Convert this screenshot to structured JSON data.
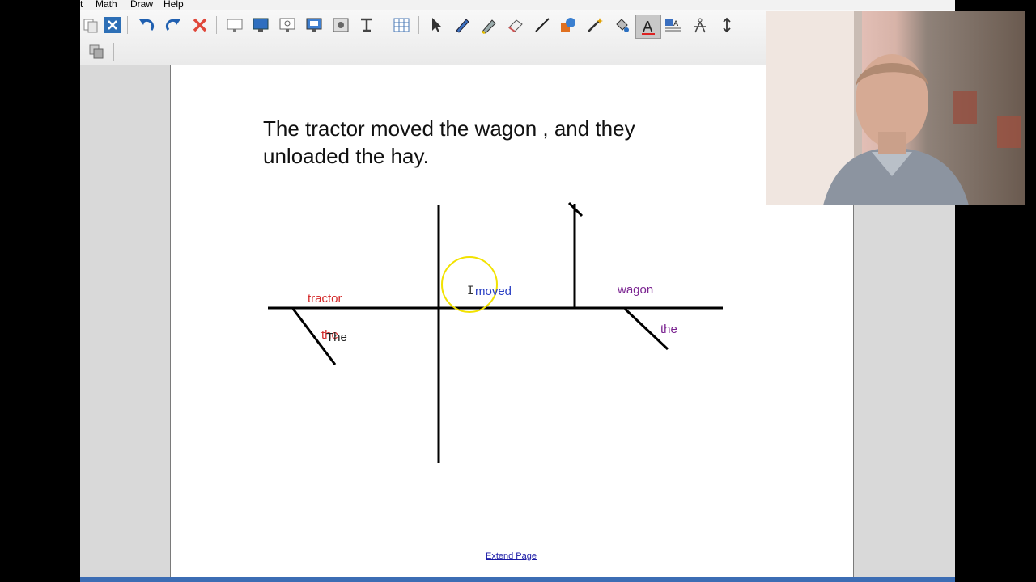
{
  "menu": [
    "t",
    "Math",
    "Draw",
    "Help"
  ],
  "toolbar": {
    "icons": [
      "copy-icon",
      "close-x-icon",
      "undo-icon",
      "redo-icon",
      "delete-icon",
      "screen-icon",
      "monitor-icon",
      "presentation-icon",
      "display-icon",
      "image-icon",
      "text-cursor-icon",
      "table-icon",
      "pointer-icon",
      "pen-icon",
      "highlighter-icon",
      "eraser-icon",
      "line-icon",
      "shape-icon",
      "magic-wand-icon",
      "fill-icon",
      "text-tool-icon",
      "text-format-icon",
      "compass-icon",
      "resize-icon",
      "layers-icon"
    ]
  },
  "page": {
    "sentence": "The tractor moved the wagon , and they unloaded the hay.",
    "extend_link": "Extend Page"
  },
  "diagram": {
    "subject": "tractor",
    "modifier_subject": "the",
    "modifier_subject_overlay": "The",
    "verb": "moved",
    "cursor_char": "I",
    "object": "wagon",
    "modifier_object": "the"
  },
  "colors": {
    "subject": "#d42a2a",
    "verb": "#2a3fc4",
    "object": "#7a2390",
    "highlight": "#f2e200"
  },
  "webcam": {
    "label": "presenter webcam"
  }
}
